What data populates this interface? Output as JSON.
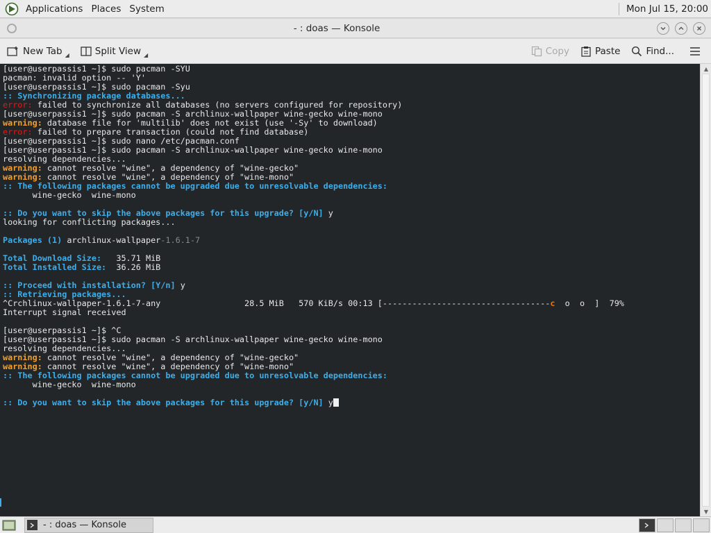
{
  "top_panel": {
    "menus": [
      "Applications",
      "Places",
      "System"
    ],
    "clock": "Mon Jul 15, 20:00"
  },
  "window": {
    "title": "- : doas — Konsole"
  },
  "toolbar": {
    "new_tab": "New Tab",
    "split_view": "Split View",
    "copy": "Copy",
    "paste": "Paste",
    "find": "Find..."
  },
  "terminal": {
    "lines": [
      [
        {
          "t": "[user@userpassis1 ~]$ sudo pacman -SYU"
        }
      ],
      [
        {
          "t": "pacman: invalid option -- 'Y'"
        }
      ],
      [
        {
          "t": "[user@userpassis1 ~]$ sudo pacman -Syu"
        }
      ],
      [
        {
          "t": ":: Synchronizing package databases...",
          "c": "b"
        }
      ],
      [
        {
          "t": "error:",
          "c": "r"
        },
        {
          "t": " failed to synchronize all databases (no servers configured for repository)"
        }
      ],
      [
        {
          "t": "[user@userpassis1 ~]$ sudo pacman -S archlinux-wallpaper wine-gecko wine-mono"
        }
      ],
      [
        {
          "t": "warning:",
          "c": "y"
        },
        {
          "t": " database file for 'multilib' does not exist (use '-Sy' to download)"
        }
      ],
      [
        {
          "t": "error:",
          "c": "r"
        },
        {
          "t": " failed to prepare transaction (could not find database)"
        }
      ],
      [
        {
          "t": "[user@userpassis1 ~]$ sudo nano /etc/pacman.conf"
        }
      ],
      [
        {
          "t": "[user@userpassis1 ~]$ sudo pacman -S archlinux-wallpaper wine-gecko wine-mono"
        }
      ],
      [
        {
          "t": "resolving dependencies..."
        }
      ],
      [
        {
          "t": "warning:",
          "c": "y"
        },
        {
          "t": " cannot resolve \"wine\", a dependency of \"wine-gecko\""
        }
      ],
      [
        {
          "t": "warning:",
          "c": "y"
        },
        {
          "t": " cannot resolve \"wine\", a dependency of \"wine-mono\""
        }
      ],
      [
        {
          "t": ":: The following packages cannot be upgraded due to unresolvable dependencies:",
          "c": "b"
        }
      ],
      [
        {
          "t": "      wine-gecko  wine-mono"
        }
      ],
      [
        {
          "t": ""
        }
      ],
      [
        {
          "t": ":: Do you want to skip the above packages for this upgrade? [y/N]",
          "c": "b"
        },
        {
          "t": " y"
        }
      ],
      [
        {
          "t": "looking for conflicting packages..."
        }
      ],
      [
        {
          "t": ""
        }
      ],
      [
        {
          "t": "Packages (1)",
          "c": "b"
        },
        {
          "t": " archlinux-wallpaper"
        },
        {
          "t": "-1.6.1-7",
          "c": "g"
        }
      ],
      [
        {
          "t": ""
        }
      ],
      [
        {
          "t": "Total Download Size:",
          "c": "b"
        },
        {
          "t": "   35.71 MiB"
        }
      ],
      [
        {
          "t": "Total Installed Size:",
          "c": "b"
        },
        {
          "t": "  36.26 MiB"
        }
      ],
      [
        {
          "t": ""
        }
      ],
      [
        {
          "t": ":: Proceed with installation? [Y/n]",
          "c": "b"
        },
        {
          "t": " y"
        }
      ],
      [
        {
          "t": ":: Retrieving packages...",
          "c": "b"
        }
      ],
      [
        {
          "t": "^Crchlinux-wallpaper-1.6.1-7-any                 28.5 MiB   570 KiB/s 00:13 [----------------------------------"
        },
        {
          "t": "c",
          "c": "o"
        },
        {
          "t": "  o  o  ]  79%"
        }
      ],
      [
        {
          "t": "Interrupt signal received"
        }
      ],
      [
        {
          "t": ""
        }
      ],
      [
        {
          "t": "[user@userpassis1 ~]$ ^C"
        }
      ],
      [
        {
          "t": "[user@userpassis1 ~]$ sudo pacman -S archlinux-wallpaper wine-gecko wine-mono"
        }
      ],
      [
        {
          "t": "resolving dependencies..."
        }
      ],
      [
        {
          "t": "warning:",
          "c": "y"
        },
        {
          "t": " cannot resolve \"wine\", a dependency of \"wine-gecko\""
        }
      ],
      [
        {
          "t": "warning:",
          "c": "y"
        },
        {
          "t": " cannot resolve \"wine\", a dependency of \"wine-mono\""
        }
      ],
      [
        {
          "t": ":: The following packages cannot be upgraded due to unresolvable dependencies:",
          "c": "b"
        }
      ],
      [
        {
          "t": "      wine-gecko  wine-mono"
        }
      ],
      [
        {
          "t": ""
        }
      ],
      [
        {
          "t": ":: Do you want to skip the above packages for this upgrade? [y/N]",
          "c": "b"
        },
        {
          "t": " y"
        },
        {
          "cursor": true
        }
      ]
    ]
  },
  "taskbar": {
    "task_title": "- : doas — Konsole"
  },
  "colors": {
    "terminal_bg": "#232629",
    "accent_blue": "#3daee9",
    "error_red": "#ed1515",
    "warning_yellow": "#f0a030"
  }
}
